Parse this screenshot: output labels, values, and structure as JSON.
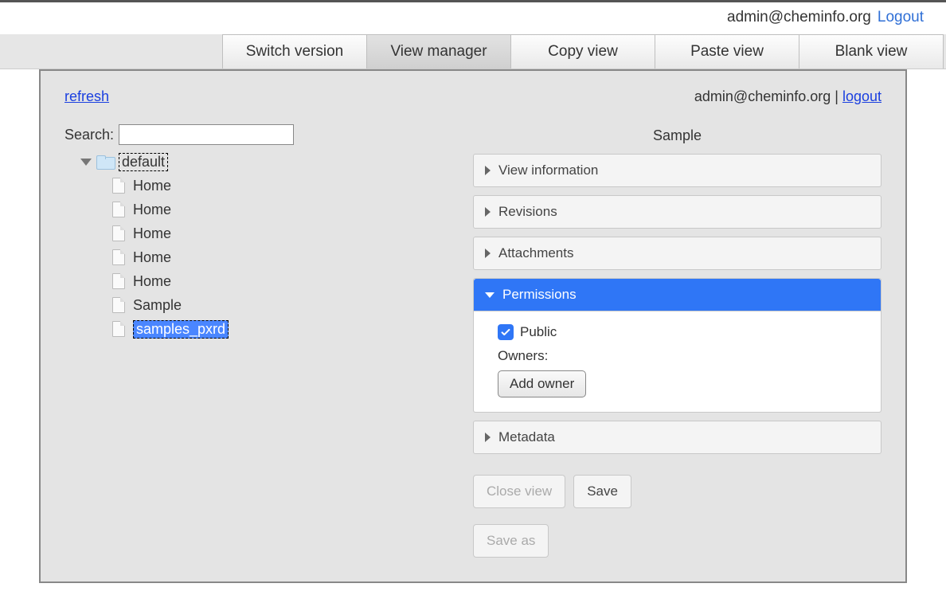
{
  "header": {
    "email": "admin@cheminfo.org",
    "logout": "Logout"
  },
  "tabs": {
    "switch_version": "Switch version",
    "view_manager": "View manager",
    "copy_view": "Copy view",
    "paste_view": "Paste view",
    "blank_view": "Blank view"
  },
  "workspace": {
    "refresh": "refresh",
    "user_email": "admin@cheminfo.org",
    "separator": " | ",
    "logout": "logout"
  },
  "search": {
    "label": "Search:",
    "value": ""
  },
  "tree": {
    "root": "default",
    "items": [
      "Home",
      "Home",
      "Home",
      "Home",
      "Home",
      "Sample",
      "samples_pxrd"
    ]
  },
  "right": {
    "title": "Sample",
    "sections": {
      "view_information": "View information",
      "revisions": "Revisions",
      "attachments": "Attachments",
      "permissions": "Permissions",
      "metadata": "Metadata"
    },
    "permissions": {
      "public_label": "Public",
      "public_checked": true,
      "owners_label": "Owners:",
      "add_owner": "Add owner"
    },
    "buttons": {
      "close_view": "Close view",
      "save": "Save",
      "save_as": "Save as"
    }
  }
}
